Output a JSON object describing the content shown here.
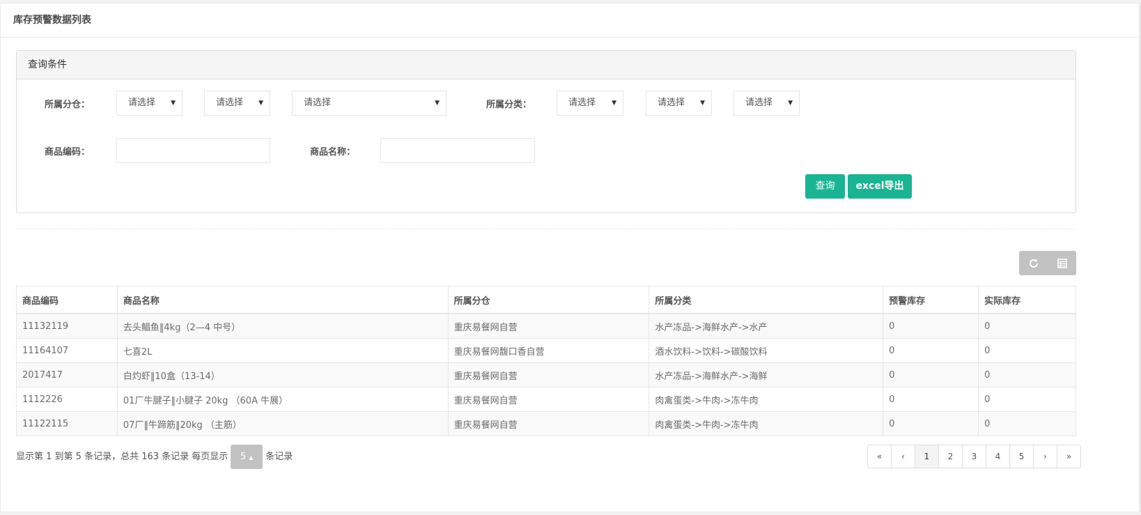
{
  "page": {
    "title": "库存预警数据列表"
  },
  "query_panel": {
    "title": "查询条件",
    "warehouse_label": "所属分仓：",
    "category_label": "所属分类：",
    "code_label": "商品编码：",
    "name_label": "商品名称：",
    "select_placeholder": "请选择",
    "query_button": "查询",
    "export_button": "excel导出"
  },
  "toolbar": {
    "refresh_icon": "refresh-icon",
    "columns_icon": "table-columns-icon"
  },
  "table": {
    "headers": [
      "商品编码",
      "商品名称",
      "所属分仓",
      "所属分类",
      "预警库存",
      "实际库存"
    ],
    "rows": [
      [
        "11132119",
        "去头鲳鱼‖4kg（2—4 中号）",
        "重庆易餐网自营",
        "水产冻品->海鲜水产->水产",
        "0",
        "0"
      ],
      [
        "11164107",
        "七喜2L",
        "重庆易餐网馥口香自营",
        "酒水饮料->饮料->碳酸饮料",
        "0",
        "0"
      ],
      [
        "2017417",
        "白灼虾‖10盒（13-14）",
        "重庆易餐网自营",
        "水产冻品->海鲜水产->海鲜",
        "0",
        "0"
      ],
      [
        "1112226",
        "01厂牛腱子‖小腱子 20kg （60A 牛展）",
        "重庆易餐网自营",
        "肉禽蛋类->牛肉->冻牛肉",
        "0",
        "0"
      ],
      [
        "11122115",
        "07厂‖牛蹄筋‖20kg （主筋）",
        "重庆易餐网自营",
        "肉禽蛋类->牛肉->冻牛肉",
        "0",
        "0"
      ]
    ]
  },
  "pagination": {
    "info_prefix": "显示第 1 到第 5 条记录，总共 163 条记录 每页显示",
    "page_size": "5",
    "info_suffix": "条记录",
    "first": "«",
    "prev": "‹",
    "pages": [
      "1",
      "2",
      "3",
      "4",
      "5"
    ],
    "next": "›",
    "last": "»",
    "active_page": "1"
  }
}
